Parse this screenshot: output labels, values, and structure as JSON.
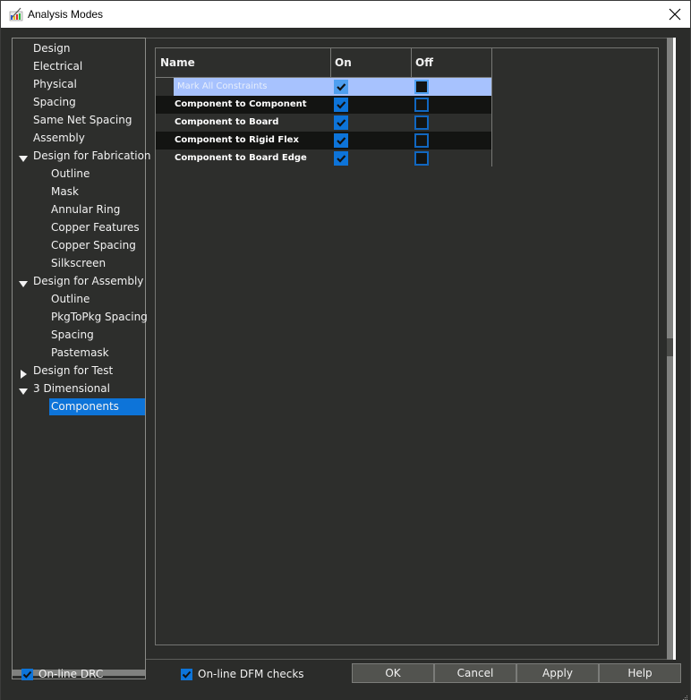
{
  "window": {
    "title": "Analysis Modes",
    "close_icon": "close-icon",
    "app_icon": "analysis-app-icon"
  },
  "tree": {
    "items": [
      {
        "label": "Design",
        "level": 0,
        "expander": "none",
        "selected": false
      },
      {
        "label": "Electrical",
        "level": 0,
        "expander": "none",
        "selected": false
      },
      {
        "label": "Physical",
        "level": 0,
        "expander": "none",
        "selected": false
      },
      {
        "label": "Spacing",
        "level": 0,
        "expander": "none",
        "selected": false
      },
      {
        "label": "Same Net Spacing",
        "level": 0,
        "expander": "none",
        "selected": false
      },
      {
        "label": "Assembly",
        "level": 0,
        "expander": "none",
        "selected": false
      },
      {
        "label": "Design for Fabrication",
        "level": 0,
        "expander": "expanded",
        "selected": false
      },
      {
        "label": "Outline",
        "level": 1,
        "expander": "none",
        "selected": false
      },
      {
        "label": "Mask",
        "level": 1,
        "expander": "none",
        "selected": false
      },
      {
        "label": "Annular Ring",
        "level": 1,
        "expander": "none",
        "selected": false
      },
      {
        "label": "Copper Features",
        "level": 1,
        "expander": "none",
        "selected": false
      },
      {
        "label": "Copper Spacing",
        "level": 1,
        "expander": "none",
        "selected": false
      },
      {
        "label": "Silkscreen",
        "level": 1,
        "expander": "none",
        "selected": false
      },
      {
        "label": "Design for Assembly",
        "level": 0,
        "expander": "expanded",
        "selected": false
      },
      {
        "label": "Outline",
        "level": 1,
        "expander": "none",
        "selected": false
      },
      {
        "label": "PkgToPkg Spacing",
        "level": 1,
        "expander": "none",
        "selected": false
      },
      {
        "label": "Spacing",
        "level": 1,
        "expander": "none",
        "selected": false
      },
      {
        "label": "Pastemask",
        "level": 1,
        "expander": "none",
        "selected": false
      },
      {
        "label": "Design for Test",
        "level": 0,
        "expander": "collapsed",
        "selected": false
      },
      {
        "label": "3 Dimensional",
        "level": 0,
        "expander": "expanded",
        "selected": false
      },
      {
        "label": "Components",
        "level": 1,
        "expander": "none",
        "selected": true
      }
    ]
  },
  "grid": {
    "columns": [
      "Name",
      "On",
      "Off"
    ],
    "rows": [
      {
        "name": "Mark All Constraints",
        "on": true,
        "off": false,
        "highlighted": true
      },
      {
        "name": "Component to Component",
        "on": true,
        "off": false,
        "highlighted": false
      },
      {
        "name": "Component to Board",
        "on": true,
        "off": false,
        "highlighted": false
      },
      {
        "name": "Component to Rigid Flex",
        "on": true,
        "off": false,
        "highlighted": false
      },
      {
        "name": "Component to Board Edge",
        "on": true,
        "off": false,
        "highlighted": false
      }
    ]
  },
  "options": {
    "online_drc": {
      "label": "On-line DRC",
      "checked": true
    },
    "online_dfm": {
      "label": "On-line DFM checks",
      "checked": true
    }
  },
  "buttons": {
    "ok": "OK",
    "cancel": "Cancel",
    "apply": "Apply",
    "help": "Help"
  },
  "colors": {
    "selection": "#0d74d9",
    "highlight_row": "#a7c2fe",
    "background": "#2b2c2a"
  }
}
